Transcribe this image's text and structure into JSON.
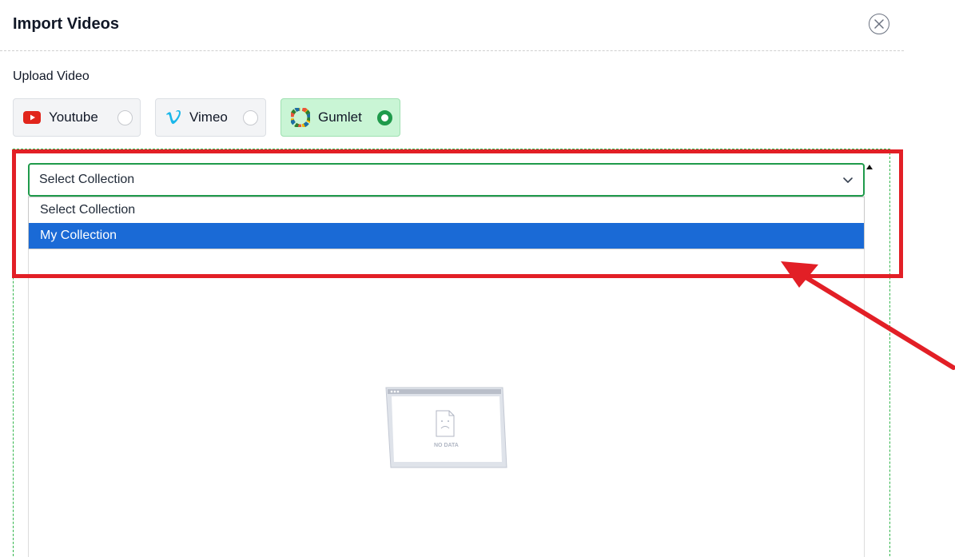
{
  "dialog": {
    "title": "Import Videos",
    "close_icon": "close-circle-icon"
  },
  "upload": {
    "label": "Upload Video",
    "platforms": [
      {
        "name": "Youtube",
        "icon": "youtube-icon",
        "selected": false
      },
      {
        "name": "Vimeo",
        "icon": "vimeo-icon",
        "selected": false
      },
      {
        "name": "Gumlet",
        "icon": "gumlet-icon",
        "selected": true
      }
    ]
  },
  "collection_select": {
    "value": "Select Collection",
    "options": [
      "Select Collection",
      "My Collection"
    ],
    "highlighted_option": "My Collection"
  },
  "empty_state": {
    "icon": "no-data-icon",
    "text": "NO DATA"
  },
  "annotation": {
    "highlight_color": "#e21f26",
    "arrow_icon": "red-arrow-icon"
  },
  "colors": {
    "accent_green": "#1f9a4b",
    "selected_platform_bg": "#c9f5d5",
    "option_highlight": "#1a6ad6"
  }
}
